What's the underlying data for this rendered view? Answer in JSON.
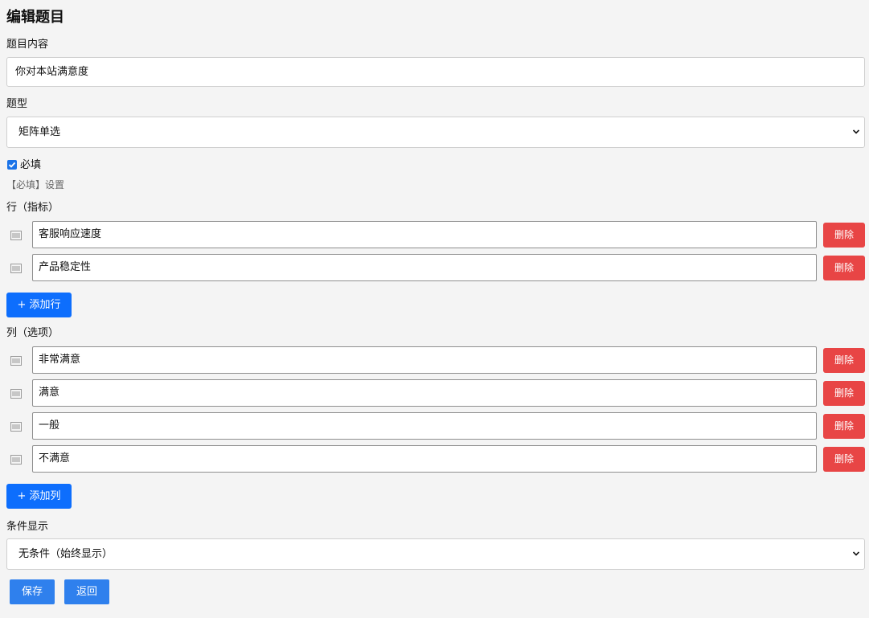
{
  "page": {
    "title": "编辑题目"
  },
  "content_field": {
    "label": "题目内容",
    "value": "你对本站满意度"
  },
  "type_field": {
    "label": "题型",
    "selected": "矩阵单选"
  },
  "required": {
    "label": "必填",
    "checked": true,
    "hint": "【必填】设置"
  },
  "rows_section": {
    "label": "行（指标）",
    "items": [
      {
        "value": "客服响应速度",
        "delete_label": "删除"
      },
      {
        "value": "产品稳定性",
        "delete_label": "删除"
      }
    ],
    "add_label": "+ 添加行"
  },
  "cols_section": {
    "label": "列（选项）",
    "items": [
      {
        "value": "非常满意",
        "delete_label": "删除"
      },
      {
        "value": "满意",
        "delete_label": "删除"
      },
      {
        "value": "一般",
        "delete_label": "删除"
      },
      {
        "value": "不满意",
        "delete_label": "删除"
      }
    ],
    "add_label": "+ 添加列"
  },
  "condition_field": {
    "label": "条件显示",
    "selected": "无条件（始终显示）"
  },
  "actions": {
    "save_label": "保存",
    "back_label": "返回"
  },
  "colors": {
    "primary": "#0d6efd",
    "danger": "#e84545",
    "save": "#2f80ed"
  },
  "icons": {
    "drag_handle": "drag-handle-icon",
    "chevron": "chevron-down-icon",
    "check": "check-icon"
  }
}
